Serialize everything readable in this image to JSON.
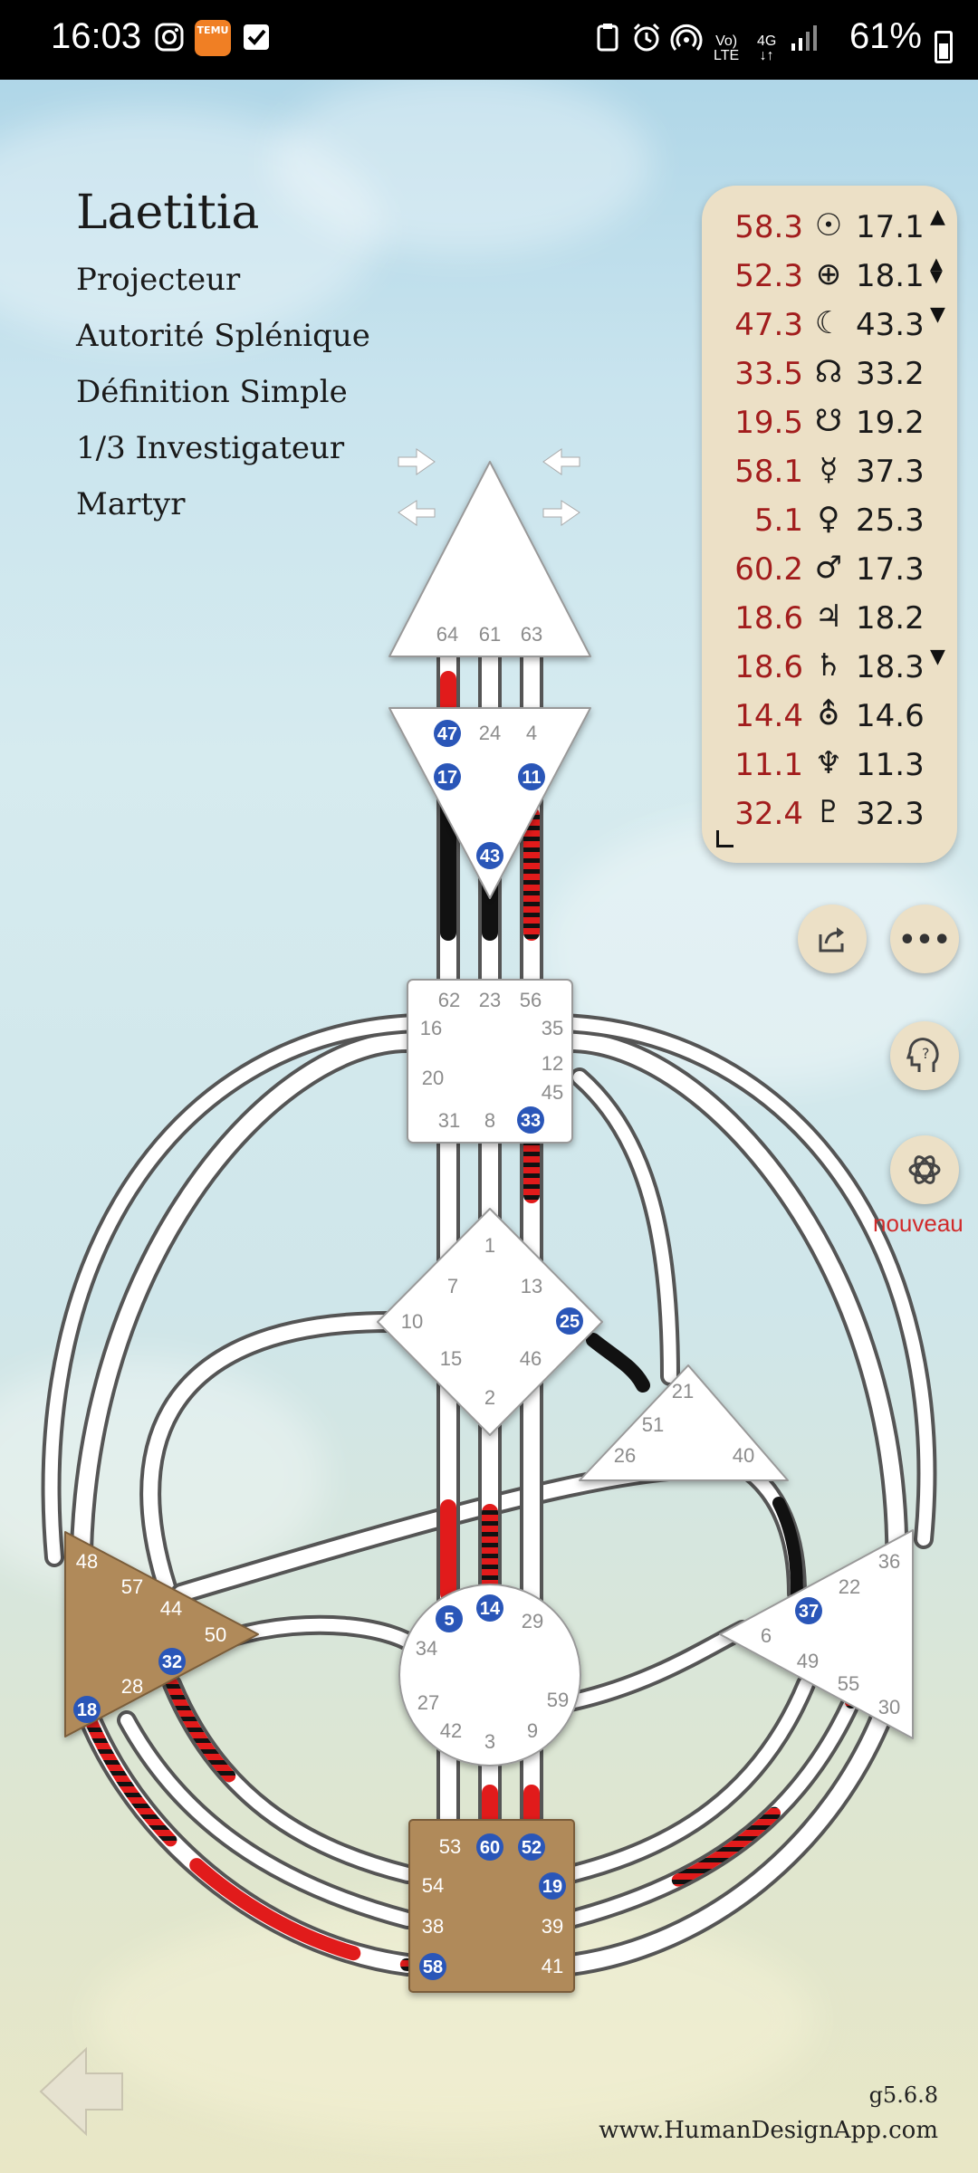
{
  "status_bar": {
    "time": "16:03",
    "battery": "61%",
    "net_top": "Vo)",
    "net_bottom": "LTE",
    "gen": "4G",
    "temu_label": "TEMU"
  },
  "profile": {
    "name": "Laetitia",
    "type": "Projecteur",
    "authority": "Autorité Splénique",
    "definition": "Définition Simple",
    "profile_line": "1/3 Investigateur",
    "not_self": "Martyr"
  },
  "planets": [
    {
      "design": "58.3",
      "symbol": "☉",
      "personality": "17.1"
    },
    {
      "design": "52.3",
      "symbol": "⊕",
      "personality": "18.1"
    },
    {
      "design": "47.3",
      "symbol": "☾",
      "personality": "43.3"
    },
    {
      "design": "33.5",
      "symbol": "☊",
      "personality": "33.2"
    },
    {
      "design": "19.5",
      "symbol": "☋",
      "personality": "19.2"
    },
    {
      "design": "58.1",
      "symbol": "☿",
      "personality": "37.3"
    },
    {
      "design": "5.1",
      "symbol": "♀",
      "personality": "25.3"
    },
    {
      "design": "60.2",
      "symbol": "♂",
      "personality": "17.3"
    },
    {
      "design": "18.6",
      "symbol": "♃",
      "personality": "18.2"
    },
    {
      "design": "18.6",
      "symbol": "♄",
      "personality": "18.3"
    },
    {
      "design": "14.4",
      "symbol": "⛢",
      "personality": "14.6"
    },
    {
      "design": "11.1",
      "symbol": "♆",
      "personality": "11.3"
    },
    {
      "design": "32.4",
      "symbol": "♇",
      "personality": "32.3"
    }
  ],
  "buttons": {
    "share_icon": "share-icon",
    "more_icon": "more-icon",
    "help_icon": "help-icon",
    "ai_icon": "openai-icon",
    "nouveau": "nouveau"
  },
  "chart": {
    "head_gates": [
      "64",
      "61",
      "63"
    ],
    "ajna_gates": [
      "47",
      "24",
      "4",
      "17",
      "11",
      "43"
    ],
    "throat_gates": [
      "62",
      "23",
      "56",
      "16",
      "35",
      "20",
      "12",
      "45",
      "31",
      "8",
      "33"
    ],
    "g_gates": [
      "1",
      "7",
      "13",
      "10",
      "25",
      "15",
      "46",
      "2"
    ],
    "ego_gates": [
      "21",
      "51",
      "26",
      "40"
    ],
    "spleen_gates": [
      "48",
      "57",
      "44",
      "50",
      "32",
      "28",
      "18"
    ],
    "sacral_gates": [
      "5",
      "14",
      "29",
      "34",
      "27",
      "59",
      "42",
      "3",
      "9"
    ],
    "solar_gates": [
      "36",
      "22",
      "37",
      "6",
      "49",
      "55",
      "30"
    ],
    "root_gates": [
      "53",
      "60",
      "52",
      "54",
      "19",
      "38",
      "39",
      "58",
      "41"
    ],
    "defined_color": "#b08a5a",
    "design_color": "#e11b1b",
    "personality_color": "#111111",
    "active_gate_color": "#2a56b8"
  },
  "footer": {
    "version": "g5.6.8",
    "website": "www.HumanDesignApp.com"
  }
}
